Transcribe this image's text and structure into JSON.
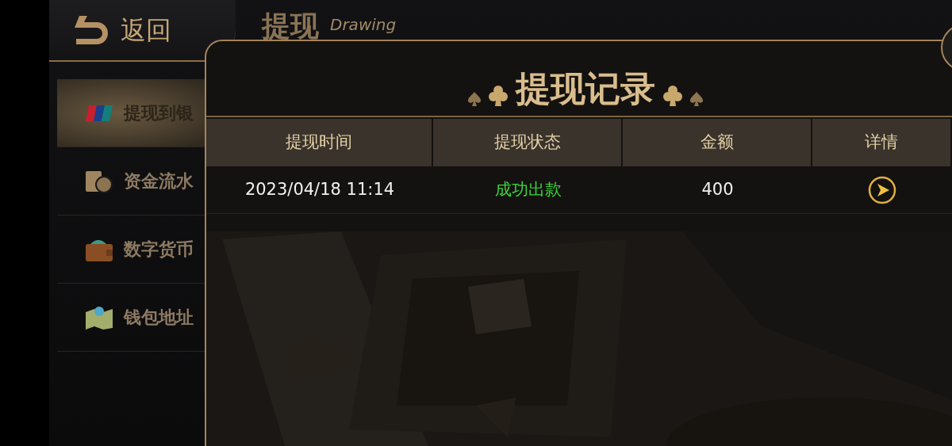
{
  "header": {
    "back_label": "返回",
    "title": "提现",
    "subtitle": "Drawing"
  },
  "sidebar": {
    "items": [
      {
        "label": "提现到银",
        "selected": true
      },
      {
        "label": "资金流水",
        "selected": false
      },
      {
        "label": "数字货币",
        "selected": false
      },
      {
        "label": "钱包地址",
        "selected": false
      }
    ]
  },
  "dialog": {
    "title": "提现记录",
    "table": {
      "columns": [
        "提现时间",
        "提现状态",
        "金额",
        "详情"
      ],
      "rows": [
        {
          "time": "2023/04/18 11:14",
          "status": "成功出款",
          "amount": "400"
        }
      ]
    }
  }
}
